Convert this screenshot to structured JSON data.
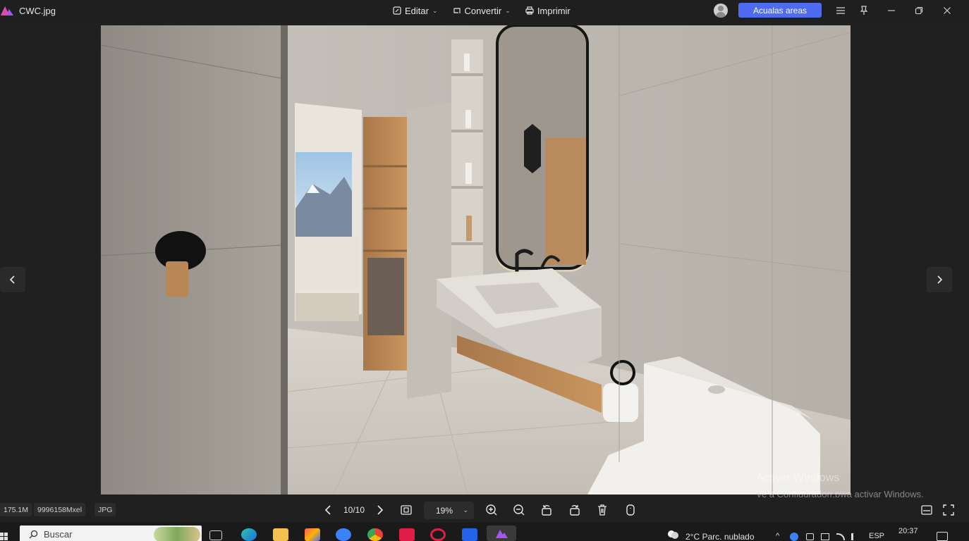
{
  "titlebar": {
    "file_name": "CWC.jpg",
    "edit_label": "Editar",
    "convert_label": "Convertir",
    "print_label": "Imprimir",
    "update_label": "Acualas areas"
  },
  "viewer": {
    "watermark_title": "Activer Windows",
    "watermark_subtitle": "Ve a Configuradorr.pwa activar Windows."
  },
  "bottombar": {
    "file_size": "175.1M",
    "dimensions": "9996158Mxel",
    "format": "JPG",
    "page_indicator": "10/10",
    "zoom_value": "19%"
  },
  "taskbar": {
    "search_placeholder": "Buscar",
    "weather": "2°C  Parc. nublado",
    "language": "ESP",
    "time": "20:37"
  },
  "colors": {
    "accent": "#4f6cf0",
    "background": "#202020"
  }
}
